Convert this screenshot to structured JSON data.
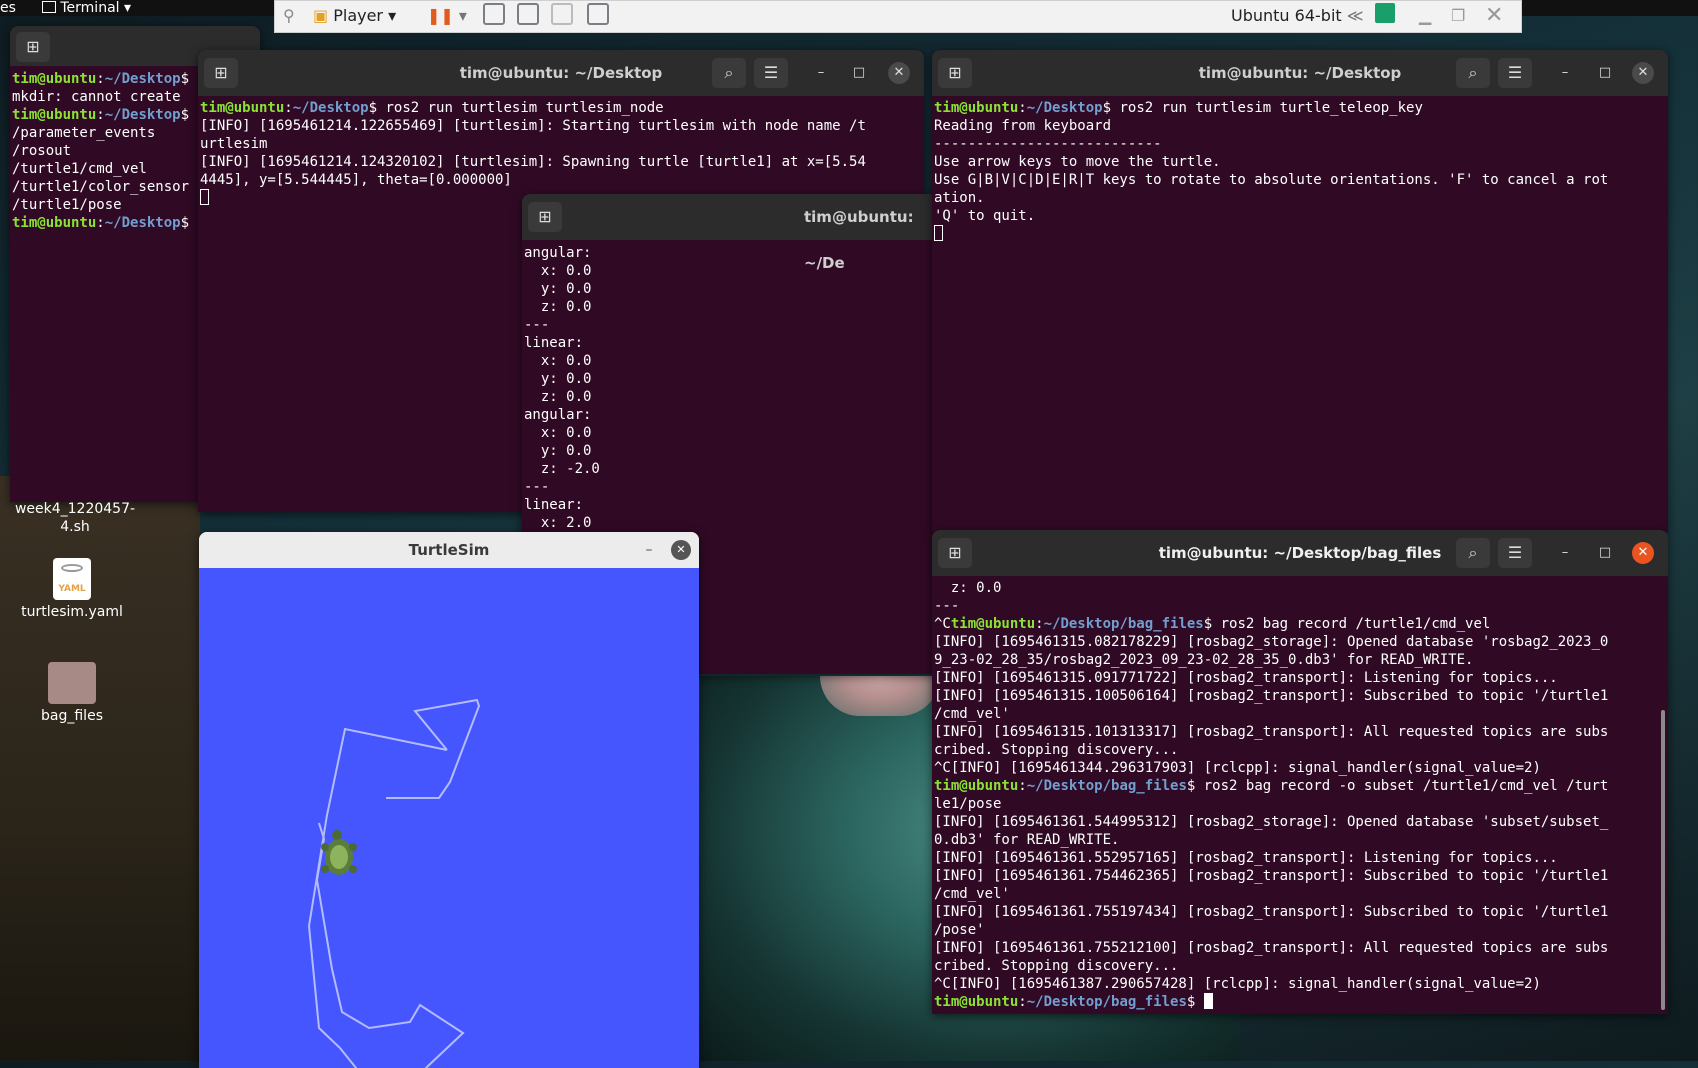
{
  "topbar": {
    "left_fragment": "es",
    "terminal_menu": "Terminal"
  },
  "player": {
    "player_label": "Player",
    "vm_name": "Ubuntu 64-bit"
  },
  "desktop": {
    "icons": [
      {
        "label": "week4_1220457-\n4.sh"
      },
      {
        "label": "turtlesim.yaml"
      },
      {
        "label": "bag_files"
      }
    ]
  },
  "windows": {
    "hidden_terminal": {
      "title": "tim@ubuntu: ~/Desktop",
      "lines": [
        {
          "user": "tim@ubuntu",
          "path": "~/Desktop",
          "cmd": ""
        },
        {
          "text": "mkdir: cannot create"
        },
        {
          "user": "tim@ubuntu",
          "path": "~/Desktop",
          "cmd": ""
        },
        {
          "text": "/parameter_events"
        },
        {
          "text": "/rosout"
        },
        {
          "text": "/turtle1/cmd_vel"
        },
        {
          "text": "/turtle1/color_sensor"
        },
        {
          "text": "/turtle1/pose"
        },
        {
          "user": "tim@ubuntu",
          "path": "~/Desktop",
          "cmd": ""
        }
      ]
    },
    "turtlesim_node": {
      "title": "tim@ubuntu: ~/Desktop",
      "prompt_user": "tim@ubuntu",
      "prompt_path": "~/Desktop",
      "cmd": " ros2 run turtlesim turtlesim_node",
      "output": "[INFO] [1695461214.122655469] [turtlesim]: Starting turtlesim with node name /t\nurtlesim\n[INFO] [1695461214.124320102] [turtlesim]: Spawning turtle [turtle1] at x=[5.54\n4445], y=[5.544445], theta=[0.000000]"
    },
    "echo_terminal": {
      "title": "tim@ubuntu: ~/De",
      "output": "angular:\n  x: 0.0\n  y: 0.0\n  z: 0.0\n---\nlinear:\n  x: 0.0\n  y: 0.0\n  z: 0.0\nangular:\n  x: 0.0\n  y: 0.0\n  z: -2.0\n---\nlinear:\n  x: 2.0"
    },
    "teleop": {
      "title": "tim@ubuntu: ~/Desktop",
      "prompt_user": "tim@ubuntu",
      "prompt_path": "~/Desktop",
      "cmd": " ros2 run turtlesim turtle_teleop_key",
      "output": "Reading from keyboard\n---------------------------\nUse arrow keys to move the turtle.\nUse G|B|V|C|D|E|R|T keys to rotate to absolute orientations. 'F' to cancel a rot\nation.\n'Q' to quit."
    },
    "turtlesim": {
      "title": "TurtleSim",
      "background": "#4556ff",
      "trail_color": "#b3bcff"
    },
    "bag_terminal": {
      "title": "tim@ubuntu: ~/Desktop/bag_files",
      "line1": "  z: 0.0",
      "line2": "---",
      "rec1_prefix": "^C",
      "rec1_user": "tim@ubuntu",
      "rec1_path": "~/Desktop/bag_files",
      "rec1_cmd": " ros2 bag record /turtle1/cmd_vel",
      "out1": "[INFO] [1695461315.082178229] [rosbag2_storage]: Opened database 'rosbag2_2023_0\n9_23-02_28_35/rosbag2_2023_09_23-02_28_35_0.db3' for READ_WRITE.\n[INFO] [1695461315.091771722] [rosbag2_transport]: Listening for topics...\n[INFO] [1695461315.100506164] [rosbag2_transport]: Subscribed to topic '/turtle1\n/cmd_vel'\n[INFO] [1695461315.101313317] [rosbag2_transport]: All requested topics are subs\ncribed. Stopping discovery...\n^C[INFO] [1695461344.296317903] [rclcpp]: signal_handler(signal_value=2)",
      "rec2_user": "tim@ubuntu",
      "rec2_path": "~/Desktop/bag_files",
      "rec2_cmd": " ros2 bag record -o subset /turtle1/cmd_vel /turt\nle1/pose",
      "out2": "[INFO] [1695461361.544995312] [rosbag2_storage]: Opened database 'subset/subset_\n0.db3' for READ_WRITE.\n[INFO] [1695461361.552957165] [rosbag2_transport]: Listening for topics...\n[INFO] [1695461361.754462365] [rosbag2_transport]: Subscribed to topic '/turtle1\n/cmd_vel'\n[INFO] [1695461361.755197434] [rosbag2_transport]: Subscribed to topic '/turtle1\n/pose'\n[INFO] [1695461361.755212100] [rosbag2_transport]: All requested topics are subs\ncribed. Stopping discovery...\n^C[INFO] [1695461387.290657428] [rclcpp]: signal_handler(signal_value=2)",
      "final_user": "tim@ubuntu",
      "final_path": "~/Desktop/bag_files"
    }
  }
}
